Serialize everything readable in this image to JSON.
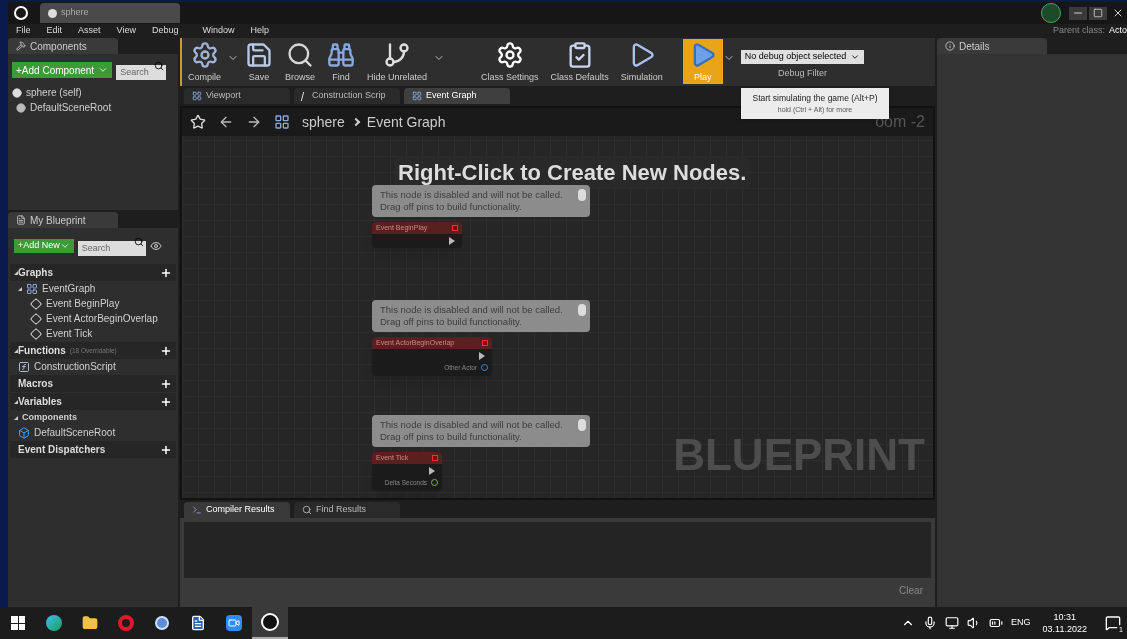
{
  "window": {
    "tab": "sphere",
    "parent_class_label": "Parent class:",
    "parent_class": "Acto"
  },
  "menu": [
    "File",
    "Edit",
    "Asset",
    "View",
    "Debug",
    "Window",
    "Help"
  ],
  "components_panel": {
    "tab": "Components",
    "add_button": "+Add Component",
    "search": {
      "placeholder": "Search"
    },
    "tree": [
      {
        "label": "sphere (self)",
        "kind": "self",
        "children": [
          {
            "label": "DefaultSceneRoot",
            "kind": "scene"
          }
        ]
      }
    ]
  },
  "my_blueprint": {
    "tab": "My Blueprint",
    "add_button": "+Add New",
    "search": {
      "placeholder": "Search"
    },
    "sections": [
      {
        "label": "Graphs",
        "expanded": true,
        "add": true,
        "children": [
          {
            "label": "EventGraph",
            "kind": "graph",
            "expanded": true,
            "children": [
              {
                "label": "Event BeginPlay",
                "kind": "event"
              },
              {
                "label": "Event ActorBeginOverlap",
                "kind": "event"
              },
              {
                "label": "Event Tick",
                "kind": "event"
              }
            ]
          }
        ]
      },
      {
        "label": "Functions",
        "note": "(18 Overridable)",
        "expanded": true,
        "add": true,
        "children": [
          {
            "label": "ConstructionScript",
            "kind": "function"
          }
        ]
      },
      {
        "label": "Macros",
        "add": true
      },
      {
        "label": "Variables",
        "expanded": true,
        "add": true,
        "children": [
          {
            "label": "Components",
            "kind": "category",
            "expanded": true,
            "children": [
              {
                "label": "DefaultSceneRoot",
                "kind": "component"
              }
            ]
          }
        ]
      },
      {
        "label": "Event Dispatchers",
        "add": true
      }
    ]
  },
  "toolbar": [
    {
      "label": "Compile",
      "kind": "compile",
      "dropdown": true,
      "selected": false
    },
    {
      "label": "Save",
      "kind": "save",
      "dropdown": false,
      "selected": false
    },
    {
      "label": "Browse",
      "kind": "browse",
      "dropdown": false,
      "selected": false
    },
    {
      "label": "Find",
      "kind": "find",
      "dropdown": false,
      "selected": false
    },
    {
      "label": "Hide Unrelated",
      "kind": "hide",
      "dropdown": true,
      "selected": false
    },
    {
      "label": "Class Settings",
      "kind": "settings",
      "dropdown": false,
      "selected": false
    },
    {
      "label": "Class Defaults",
      "kind": "defaults",
      "dropdown": false,
      "selected": false
    },
    {
      "label": "Simulation",
      "kind": "simulation",
      "dropdown": false,
      "selected": false
    },
    {
      "label": "Play",
      "kind": "play",
      "dropdown": true,
      "selected": true
    }
  ],
  "debug_filter": {
    "value": "No debug object selected",
    "label": "Debug Filter"
  },
  "tooltip": {
    "title": "Start simulating the game (Alt+P)",
    "hint": "hold (Ctrl + Alt) for more"
  },
  "editor_tabs": [
    {
      "label": "Viewport",
      "kind": "viewport",
      "selected": false
    },
    {
      "label": "Construction Scrip",
      "kind": "function",
      "selected": false
    },
    {
      "label": "Event Graph",
      "kind": "graph",
      "selected": true
    }
  ],
  "breadcrumb": {
    "blueprint": "sphere",
    "graph": "Event Graph",
    "zoom": "oom -2"
  },
  "graph": {
    "hint": "Right-Click to Create New Nodes.",
    "watermark": "BLUEPRINT",
    "nodes": [
      {
        "comment": [
          "This node is disabled and will not be called.",
          "Drag off pins to build functionality."
        ],
        "title": "Event BeginPlay",
        "pins": [
          {
            "kind": "exec"
          }
        ]
      },
      {
        "comment": [
          "This node is disabled and will not be called.",
          "Drag off pins to build functionality."
        ],
        "title": "Event ActorBeginOverlap",
        "pins": [
          {
            "kind": "exec"
          },
          {
            "kind": "object",
            "label": "Other Actor"
          }
        ]
      },
      {
        "comment": [
          "This node is disabled and will not be called.",
          "Drag off pins to build functionality."
        ],
        "title": "Event Tick",
        "pins": [
          {
            "kind": "exec"
          },
          {
            "kind": "float",
            "label": "Delta Seconds"
          }
        ]
      }
    ]
  },
  "bottom_panel": {
    "tabs": [
      {
        "label": "Compiler Results",
        "kind": "compiler",
        "selected": true
      },
      {
        "label": "Find Results",
        "kind": "find",
        "selected": false
      }
    ],
    "clear_button": "Clear"
  },
  "details_panel": {
    "tab": "Details"
  },
  "taskbar": {
    "apps": [
      {
        "kind": "start",
        "active": false
      },
      {
        "kind": "edge",
        "active": false
      },
      {
        "kind": "explorer",
        "active": false
      },
      {
        "kind": "opera",
        "active": false
      },
      {
        "kind": "app",
        "active": false
      },
      {
        "kind": "word",
        "active": false
      },
      {
        "kind": "zoom",
        "active": false
      },
      {
        "kind": "unreal",
        "active": true
      }
    ],
    "language": "ENG",
    "time": "10:31",
    "date": "03.11.2022",
    "notifications": "1"
  }
}
